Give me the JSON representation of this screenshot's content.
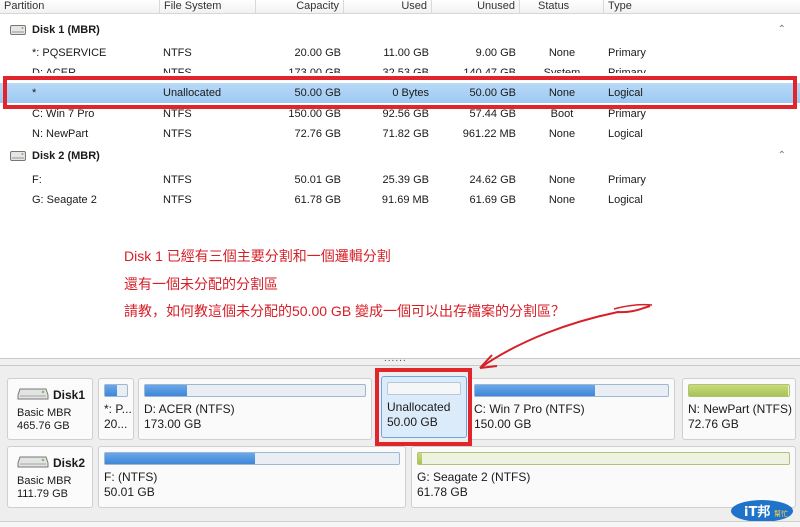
{
  "columns": {
    "partition": "Partition",
    "file_system": "File System",
    "capacity": "Capacity",
    "used": "Used",
    "unused": "Unused",
    "status": "Status",
    "type": "Type"
  },
  "disk1_group": {
    "label": "Disk 1 (MBR)"
  },
  "disk2_group": {
    "label": "Disk 2 (MBR)"
  },
  "disk1_rows": [
    {
      "partition": "*: PQSERVICE",
      "fs": "NTFS",
      "capacity": "20.00 GB",
      "used": "11.00 GB",
      "unused": "9.00 GB",
      "status": "None",
      "type": "Primary"
    },
    {
      "partition": "D: ACER",
      "fs": "NTFS",
      "capacity": "173.00 GB",
      "used": "32.53 GB",
      "unused": "140.47 GB",
      "status": "System",
      "type": "Primary"
    },
    {
      "partition": "*",
      "fs": "Unallocated",
      "capacity": "50.00 GB",
      "used": "0 Bytes",
      "unused": "50.00 GB",
      "status": "None",
      "type": "Logical"
    },
    {
      "partition": "C: Win 7 Pro",
      "fs": "NTFS",
      "capacity": "150.00 GB",
      "used": "92.56 GB",
      "unused": "57.44 GB",
      "status": "Boot",
      "type": "Primary"
    },
    {
      "partition": "N: NewPart",
      "fs": "NTFS",
      "capacity": "72.76 GB",
      "used": "71.82 GB",
      "unused": "961.22 MB",
      "status": "None",
      "type": "Logical"
    }
  ],
  "disk2_rows": [
    {
      "partition": "F:",
      "fs": "NTFS",
      "capacity": "50.01 GB",
      "used": "25.39 GB",
      "unused": "24.62 GB",
      "status": "None",
      "type": "Primary"
    },
    {
      "partition": "G: Seagate 2",
      "fs": "NTFS",
      "capacity": "61.78 GB",
      "used": "91.69 MB",
      "unused": "61.69 GB",
      "status": "None",
      "type": "Logical"
    }
  ],
  "annotation": {
    "line1": "Disk 1 已經有三個主要分割和一個邏輯分割",
    "line2": "還有一個未分配的分割區",
    "line3": "請教，如何教這個未分配的50.00 GB 變成一個可以出存檔案的分割區？"
  },
  "splitter_dots": "......",
  "disk_map": {
    "disk1": {
      "name": "Disk1",
      "type": "Basic MBR",
      "size": "465.76 GB"
    },
    "disk2": {
      "name": "Disk2",
      "type": "Basic MBR",
      "size": "111.79 GB"
    },
    "disk1_parts": [
      {
        "name": "*: P...",
        "size": "20...",
        "fill": 0.55
      },
      {
        "name": "D: ACER (NTFS)",
        "size": "173.00 GB",
        "fill": 0.19
      },
      {
        "name": "Unallocated",
        "size": "50.00 GB",
        "fill": 0
      },
      {
        "name": "C: Win 7 Pro (NTFS)",
        "size": "150.00 GB",
        "fill": 0.62
      },
      {
        "name": "N: NewPart (NTFS)",
        "size": "72.76 GB",
        "fill": 0.99
      }
    ],
    "disk2_parts": [
      {
        "name": "F: (NTFS)",
        "size": "50.01 GB",
        "fill": 0.51
      },
      {
        "name": "G: Seagate 2 (NTFS)",
        "size": "61.78 GB",
        "fill": 0.01
      }
    ]
  },
  "logo": {
    "main": "iT邦",
    "sub": "幫忙"
  },
  "colors": {
    "accent_red": "#e0262a",
    "selection_blue": "#9ccaf2",
    "used_bar_blue": "#3f86d8",
    "logical_bar_green": "#a9c256"
  }
}
